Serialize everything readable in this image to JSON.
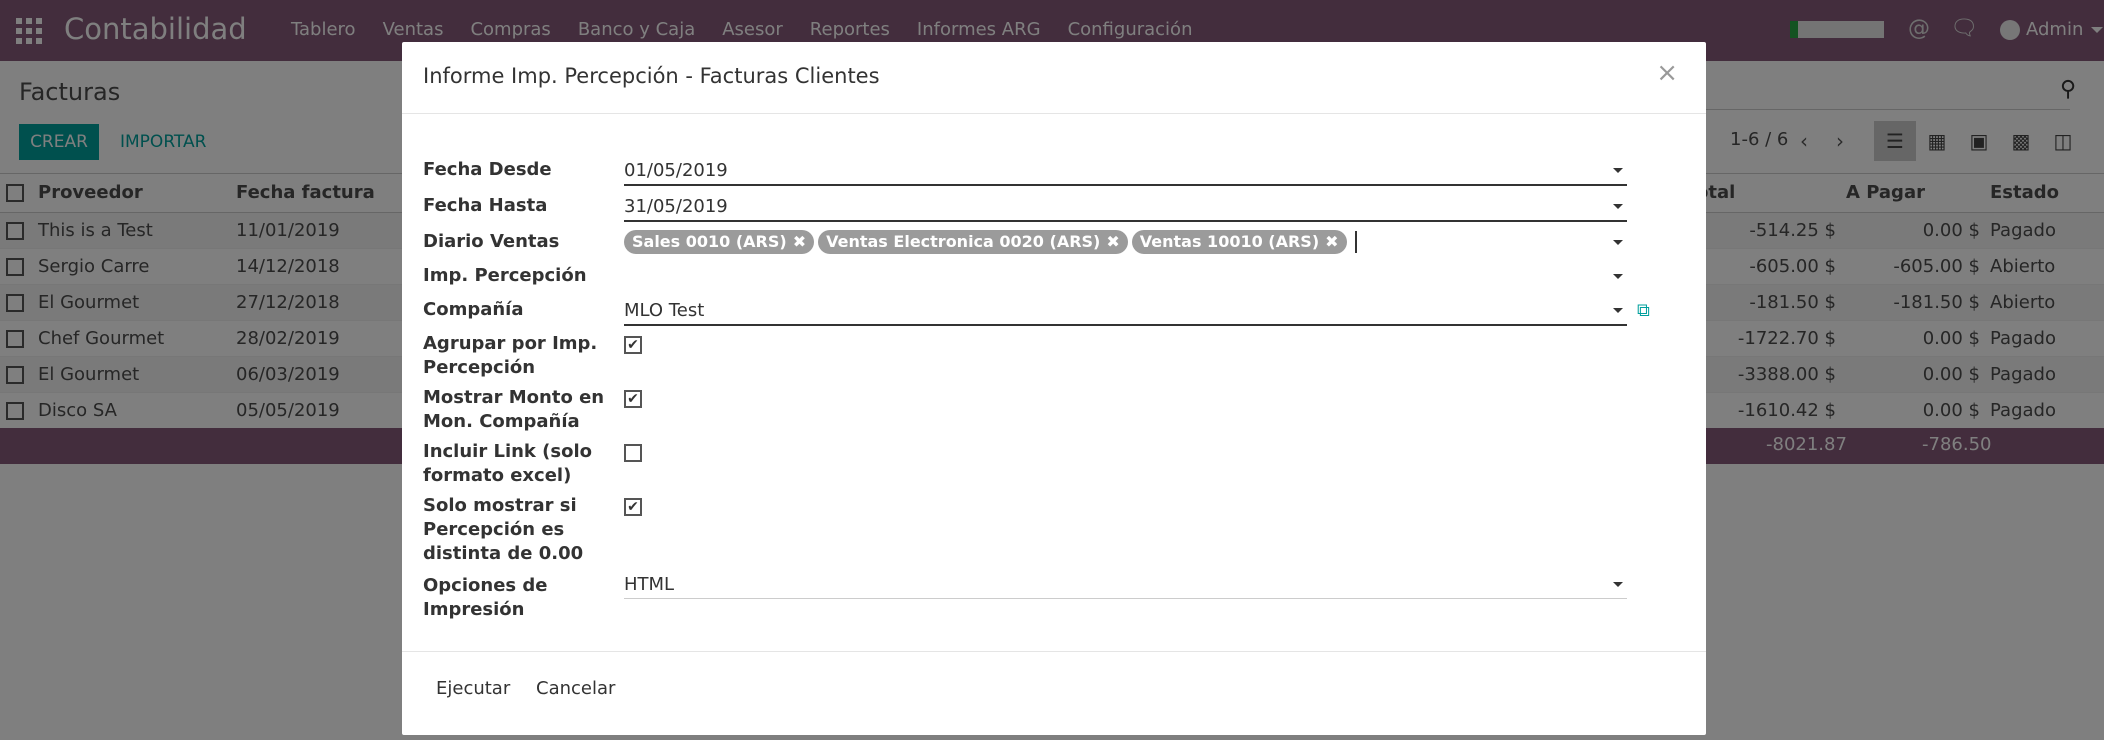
{
  "navbar": {
    "brand": "Contabilidad",
    "menus": [
      "Tablero",
      "Ventas",
      "Compras",
      "Banco y Caja",
      "Asesor",
      "Reportes",
      "Informes ARG",
      "Configuración"
    ],
    "user": "Admin",
    "progress": 0.08,
    "accent": "#875a7b"
  },
  "control_panel": {
    "breadcrumb": "Facturas",
    "create_label": "CREAR",
    "import_label": "IMPORTAR",
    "pager": "1-6 / 6"
  },
  "list": {
    "headers": {
      "provider": "Proveedor",
      "date": "Fecha factura",
      "total": "otal",
      "due": "A Pagar",
      "state": "Estado"
    },
    "rows": [
      {
        "provider": "This is a Test",
        "date": "11/01/2019",
        "total": "-514.25 $",
        "due": "0.00 $",
        "state": "Pagado"
      },
      {
        "provider": "Sergio Carre",
        "date": "14/12/2018",
        "total": "-605.00 $",
        "due": "-605.00 $",
        "state": "Abierto"
      },
      {
        "provider": "El Gourmet",
        "date": "27/12/2018",
        "total": "-181.50 $",
        "due": "-181.50 $",
        "state": "Abierto"
      },
      {
        "provider": "Chef Gourmet",
        "date": "28/02/2019",
        "total": "-1722.70 $",
        "due": "0.00 $",
        "state": "Pagado"
      },
      {
        "provider": "El Gourmet",
        "date": "06/03/2019",
        "total": "-3388.00 $",
        "due": "0.00 $",
        "state": "Pagado"
      },
      {
        "provider": "Disco SA",
        "date": "05/05/2019",
        "total": "-1610.42 $",
        "due": "0.00 $",
        "state": "Pagado"
      }
    ],
    "sum_total": "-8021.87",
    "sum_due": "-786.50"
  },
  "modal": {
    "title": "Informe Imp. Percepción - Facturas Clientes",
    "fields": {
      "date_from_label": "Fecha Desde",
      "date_from": "01/05/2019",
      "date_to_label": "Fecha Hasta",
      "date_to": "31/05/2019",
      "journals_label": "Diario Ventas",
      "journals": [
        "Sales 0010 (ARS)",
        "Ventas Electronica 0020 (ARS)",
        "Ventas 10010 (ARS)"
      ],
      "tax_label": "Imp. Percepción",
      "company_label": "Compañía",
      "company": "MLO Test",
      "group_label": "Agrupar por Imp. Percepción",
      "group": true,
      "show_company_label": "Mostrar Monto en Mon. Compañía",
      "show_company": true,
      "link_label": "Incluir Link (solo formato excel)",
      "link": false,
      "nonzero_label": "Solo mostrar si Percepción es distinta de 0.00",
      "nonzero": true,
      "print_label": "Opciones de Impresión",
      "print": "HTML"
    },
    "execute_label": "Ejecutar",
    "cancel_label": "Cancelar"
  }
}
